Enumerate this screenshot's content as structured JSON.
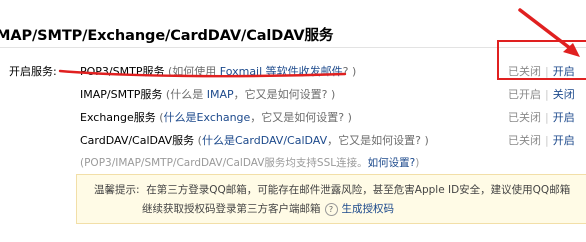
{
  "section_title": "MAP/SMTP/Exchange/CardDAV/CalDAV服务",
  "label": "开启服务:",
  "services": [
    {
      "name": "POP3/SMTP服务",
      "note_prefix": " (如何使用 ",
      "note_link": "Foxmail 等软件收发邮件",
      "note_suffix": "? )",
      "status": "已关闭",
      "action": "开启"
    },
    {
      "name": "IMAP/SMTP服务",
      "note_prefix": " (什么是 ",
      "note_link": "IMAP",
      "note_suffix": "，它又是如何设置? )",
      "status": "已开启",
      "action": "关闭"
    },
    {
      "name": "Exchange服务",
      "note_prefix": " (",
      "note_link": "什么是Exchange",
      "note_suffix": "，它又是如何设置? )",
      "status": "已关闭",
      "action": "开启"
    },
    {
      "name": "CardDAV/CalDAV服务",
      "note_prefix": " (",
      "note_link": "什么是CardDAV/CalDAV",
      "note_suffix": "，它又是如何设置? )",
      "status": "已关闭",
      "action": "开启"
    }
  ],
  "ssl_note": "(POP3/IMAP/SMTP/CardDAV/CalDAV服务均支持SSL连接。",
  "ssl_link": "如何设置?",
  "ssl_end": ")",
  "tip": {
    "prefix": "温馨提示:",
    "line1": "在第三方登录QQ邮箱，可能存在邮件泄露风险，甚至危害Apple ID安全，建议使用QQ邮箱",
    "line2": "继续获取授权码登录第三方客户端邮箱",
    "help_icon_text": "?",
    "link": "生成授权码"
  },
  "annotation_color": "#e02020"
}
